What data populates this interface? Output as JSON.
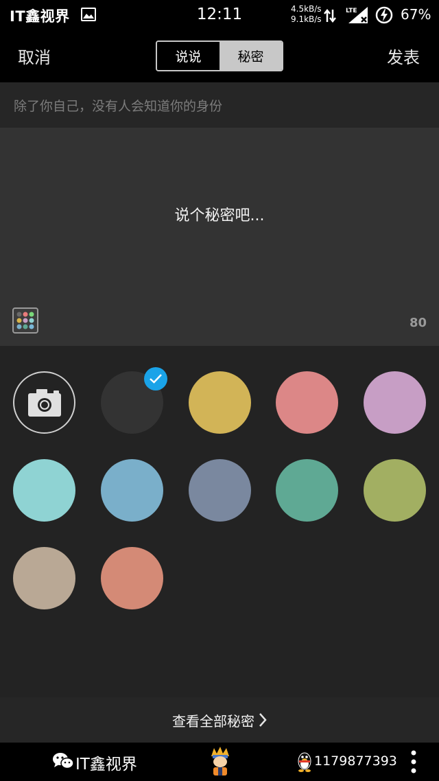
{
  "status_bar": {
    "brand": "IT鑫视界",
    "time": "12:11",
    "net_up": "4.5kB/s",
    "net_down": "9.1kB/s",
    "network_type": "LTE",
    "battery": "67%",
    "icons": [
      "gallery-icon",
      "data-arrows-icon",
      "signal-icon",
      "charging-icon"
    ]
  },
  "header": {
    "cancel_label": "取消",
    "publish_label": "发表",
    "tabs": [
      {
        "label": "说说",
        "active": false
      },
      {
        "label": "秘密",
        "active": true
      }
    ]
  },
  "hint": "除了你自己，没有人会知道你的身份",
  "composer": {
    "placeholder": "说个秘密吧...",
    "char_count": "80",
    "palette_icon": "color-palette-icon"
  },
  "backgrounds": {
    "selected_index": 0,
    "camera_icon": "camera-icon",
    "colors": [
      "#333333",
      "#d2b457",
      "#dc8787",
      "#c79ec5",
      "#8fd3d3",
      "#7aafca",
      "#7a889f",
      "#5fa994",
      "#a2af62",
      "#b9a895",
      "#d48a76"
    ]
  },
  "footer": {
    "view_all_label": "查看全部秘密"
  },
  "watermark": {
    "wechat_name": "IT鑫视界",
    "qq_number": "1179877393"
  },
  "colors": {
    "accent": "#1aa3e8",
    "segment_active": "#c8c8c8",
    "panel": "#333333",
    "grid_bg": "#232323"
  }
}
